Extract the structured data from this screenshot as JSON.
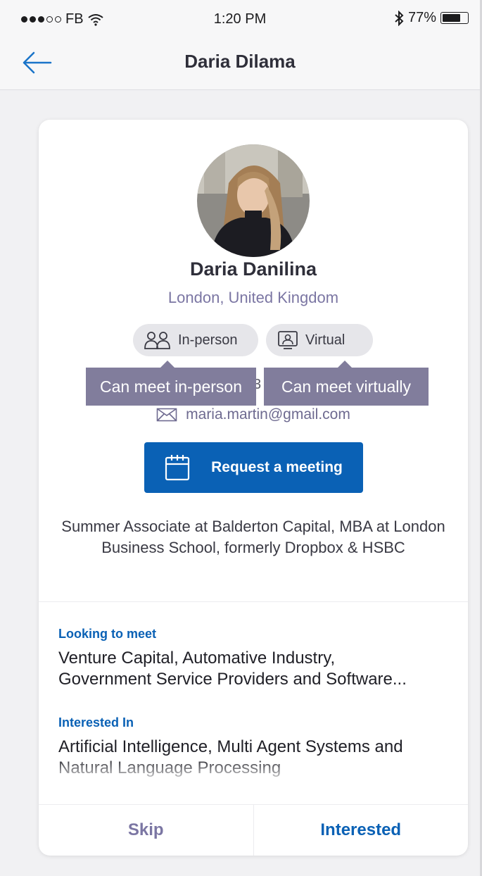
{
  "status_bar": {
    "carrier": "FB",
    "time": "1:20 PM",
    "battery_percent": "77%",
    "battery_level": 0.77,
    "signal_bars_filled": 3,
    "signal_bars_total": 5
  },
  "nav": {
    "title": "Daria Dilama",
    "back_icon": "arrow-left-icon"
  },
  "profile": {
    "name": "Daria Danilina",
    "location": "London, United Kingdom",
    "meeting_modes": [
      {
        "label": "In-person",
        "icon": "people-icon",
        "tooltip": "Can meet in-person"
      },
      {
        "label": "Virtual",
        "icon": "video-call-icon",
        "tooltip": "Can meet virtually"
      }
    ],
    "phone_fragment": "3",
    "email": "maria.martin@gmail.com",
    "request_button": "Request a meeting",
    "bio": "Summer Associate at Balderton Capital, MBA at London Business School, formerly Dropbox & HSBC"
  },
  "sections": [
    {
      "label": "Looking to meet",
      "text": "Venture Capital, Automative Industry, Government Service Providers and Software Engineering"
    },
    {
      "label": "Interested In",
      "text": "Artificial Intelligence, Multi Agent Systems and Natural Language Processing"
    }
  ],
  "footer": {
    "skip": "Skip",
    "interested": "Interested"
  },
  "colors": {
    "accent": "#0a61b5",
    "tooltip_bg": "#817d9c",
    "muted_purple": "#7b76a3",
    "background": "#f1f1f3"
  }
}
